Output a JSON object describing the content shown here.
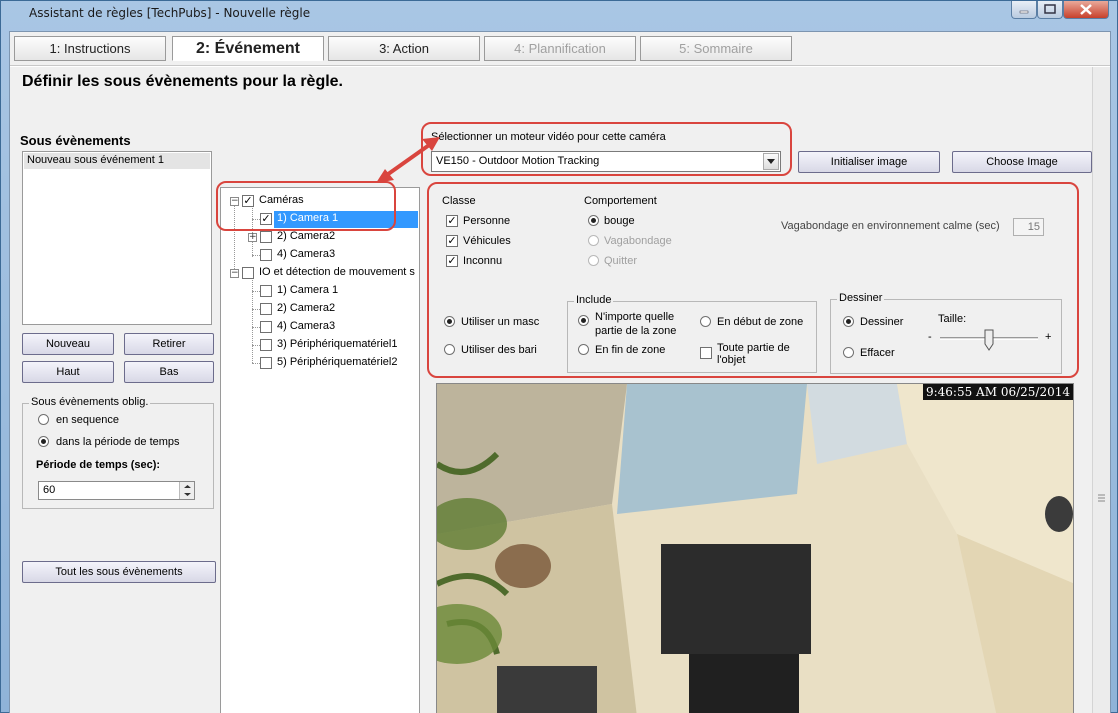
{
  "window": {
    "title": "Assistant de règles [TechPubs] - Nouvelle règle"
  },
  "tabs": [
    {
      "label": "1: Instructions",
      "state": "normal"
    },
    {
      "label": "2: Événement",
      "state": "active"
    },
    {
      "label": "3: Action",
      "state": "normal"
    },
    {
      "label": "4: Plannification",
      "state": "disabled"
    },
    {
      "label": "5: Sommaire",
      "state": "disabled"
    }
  ],
  "page": {
    "heading": "Définir les sous évènements pour la règle."
  },
  "left": {
    "title": "Sous évènements",
    "list_items": [
      "Nouveau sous événement 1"
    ],
    "buttons": {
      "new": "Nouveau",
      "remove": "Retirer",
      "up": "Haut",
      "down": "Bas",
      "all": "Tout les sous évènements"
    },
    "required_group": {
      "title": "Sous évènements oblig.",
      "option_sequence": "en sequence",
      "option_period": "dans la période de temps",
      "selected": "dans la période de temps",
      "period_label": "Période de temps (sec):",
      "period_value": "60"
    }
  },
  "tree": {
    "nodes": [
      {
        "label": "Caméras",
        "checked": true,
        "expanded": true
      },
      {
        "label": "1) Camera 1",
        "checked": true,
        "selected": true
      },
      {
        "label": "2) Camera2",
        "checked": false,
        "expandable": true
      },
      {
        "label": "4) Camera3",
        "checked": false
      },
      {
        "label": "IO et détection de mouvement s",
        "checked": false,
        "expanded": true
      },
      {
        "label": "1) Camera 1",
        "checked": false
      },
      {
        "label": "2) Camera2",
        "checked": false
      },
      {
        "label": "4) Camera3",
        "checked": false
      },
      {
        "label": "3) Périphériquematériel1",
        "checked": false
      },
      {
        "label": "5) Périphériquematériel2",
        "checked": false
      }
    ]
  },
  "engine": {
    "label": "Sélectionner un moteur vidéo pour cette caméra",
    "selected": "VE150 - Outdoor Motion Tracking",
    "init_button": "Initialiser image",
    "choose_button": "Choose Image"
  },
  "classe": {
    "title": "Classe",
    "items": [
      {
        "label": "Personne",
        "checked": true
      },
      {
        "label": "Véhicules",
        "checked": true
      },
      {
        "label": "Inconnu",
        "checked": true
      }
    ]
  },
  "comportement": {
    "title": "Comportement",
    "items": [
      {
        "label": "bouge",
        "selected": true,
        "enabled": true
      },
      {
        "label": "Vagabondage",
        "selected": false,
        "enabled": false
      },
      {
        "label": "Quitter",
        "selected": false,
        "enabled": false
      }
    ],
    "loiter_label": "Vagabondage en environnement calme (sec)",
    "loiter_value": "15"
  },
  "mask": {
    "use_mask": "Utiliser un masc",
    "use_bars": "Utiliser des bari",
    "selected": "Utiliser un masc"
  },
  "include": {
    "title": "Include",
    "any_part": "N'importe quelle partie de la zone",
    "start_zone": "En début de zone",
    "end_zone": "En fin de zone",
    "whole_object": "Toute partie de l'objet",
    "selected": "N'importe quelle partie de la zone",
    "whole_object_checked": false
  },
  "draw": {
    "title": "Dessiner",
    "draw": "Dessiner",
    "erase": "Effacer",
    "selected": "Dessiner",
    "size_label": "Taille:",
    "minus": "-",
    "plus": "+",
    "size_level": 0.5
  },
  "video": {
    "timestamp": "9:46:55 AM 06/25/2014"
  },
  "colors": {
    "highlight": "#3399ff",
    "annotation": "#d9453e",
    "panel": "#f0f0f0"
  }
}
